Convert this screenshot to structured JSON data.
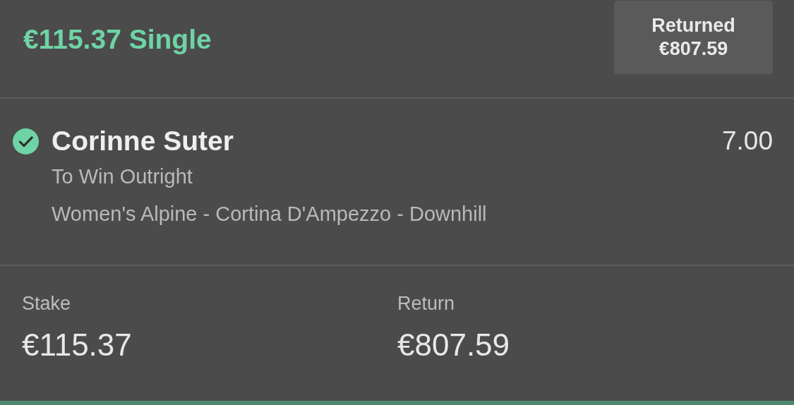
{
  "header": {
    "title": "€115.37 Single",
    "badge": {
      "label": "Returned",
      "amount": "€807.59"
    }
  },
  "selection": {
    "won": true,
    "name": "Corinne Suter",
    "odds": "7.00",
    "market": "To Win Outright",
    "event": "Women's Alpine - Cortina D'Ampezzo - Downhill"
  },
  "summary": [
    {
      "label": "Stake",
      "value": "€115.37"
    },
    {
      "label": "Return",
      "value": "€807.59"
    }
  ]
}
